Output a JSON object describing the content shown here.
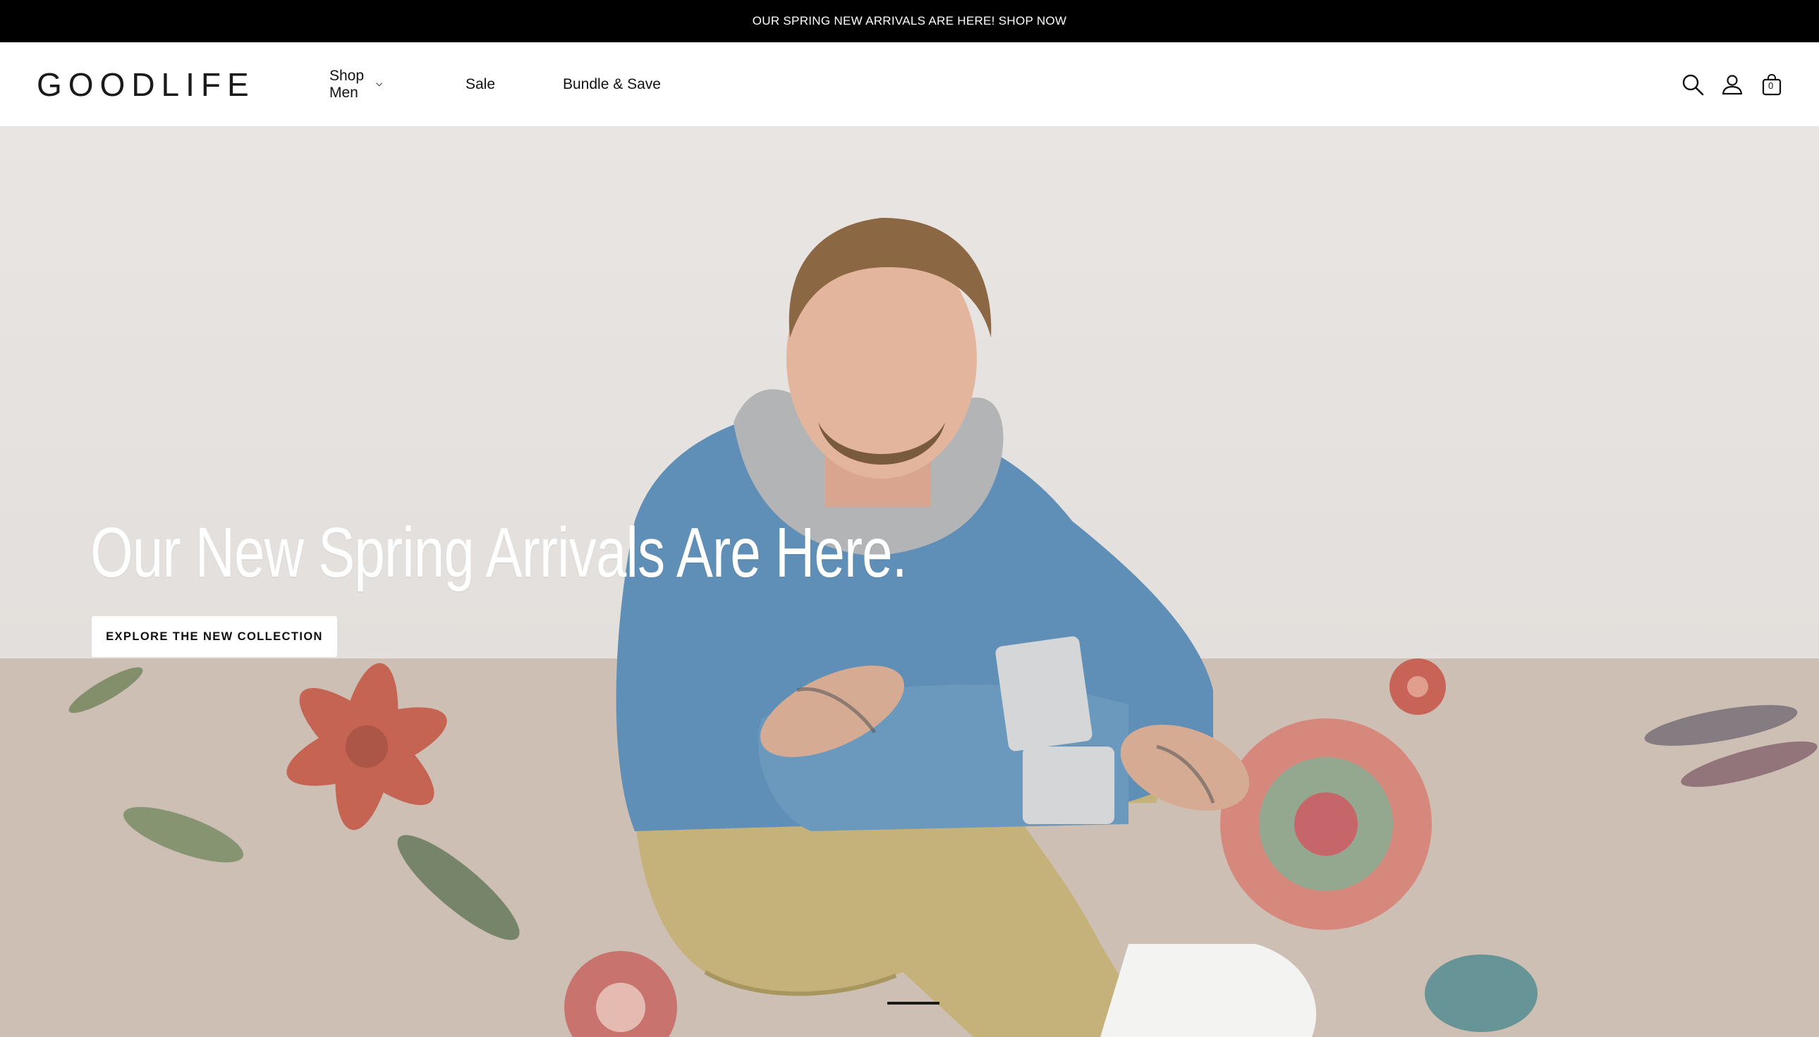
{
  "announcement": {
    "text": "OUR SPRING NEW ARRIVALS ARE HERE! SHOP NOW"
  },
  "header": {
    "logo": "GOODLIFE",
    "nav": [
      {
        "label": "Shop Men",
        "has_dropdown": true
      },
      {
        "label": "Sale",
        "has_dropdown": false
      },
      {
        "label": "Bundle & Save",
        "has_dropdown": false
      }
    ],
    "icons": [
      "search-icon",
      "account-icon",
      "cart-icon"
    ],
    "cart_count": "0"
  },
  "hero": {
    "title": "Our New Spring Arrivals Are Here.",
    "cta_label": "EXPLORE THE NEW COLLECTION",
    "slide_indicator": {
      "active": 1
    }
  },
  "colors": {
    "announcement_bg": "#000000",
    "cta_bg": "#ffffff",
    "hero_text": "#ffffff"
  }
}
